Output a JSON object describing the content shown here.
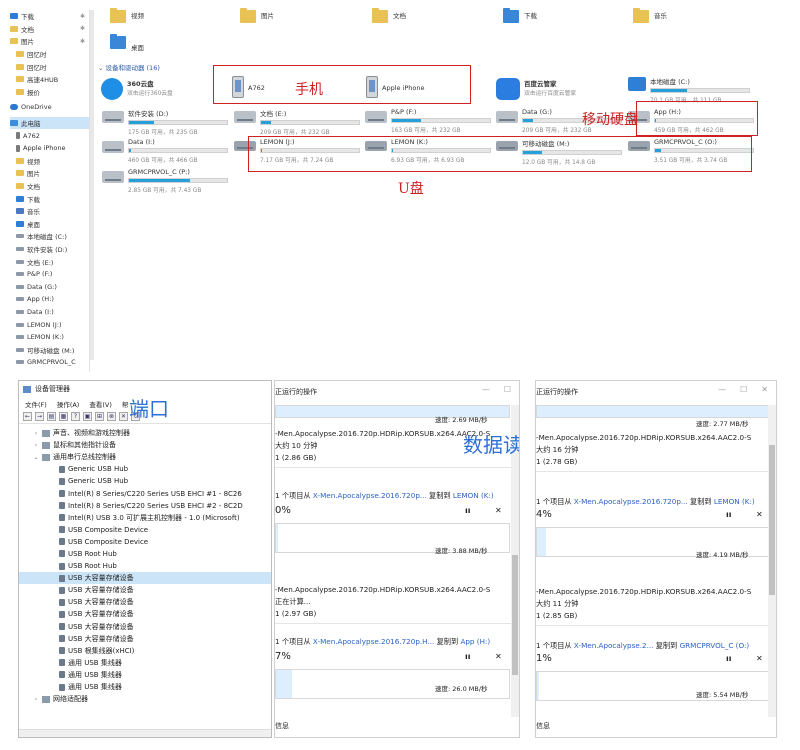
{
  "explorer": {
    "nav": [
      {
        "label": "下载",
        "icon": "download-icon",
        "pin": true
      },
      {
        "label": "文档",
        "icon": "document-icon",
        "pin": true
      },
      {
        "label": "图片",
        "icon": "pictures-icon",
        "pin": true
      },
      {
        "label": "回忆时",
        "icon": "folder-icon"
      },
      {
        "label": "回忆时",
        "icon": "folder-icon"
      },
      {
        "label": "高速4HUB",
        "icon": "folder-icon"
      },
      {
        "label": "报价",
        "icon": "folder-icon"
      },
      {
        "label": "OneDrive",
        "icon": "cloud-icon"
      },
      {
        "label": "此电脑",
        "icon": "computer-icon"
      },
      {
        "label": "A762",
        "icon": "phone-icon"
      },
      {
        "label": "Apple iPhone",
        "icon": "phone-icon"
      },
      {
        "label": "视频",
        "icon": "video-icon"
      },
      {
        "label": "图片",
        "icon": "pictures-icon"
      },
      {
        "label": "文档",
        "icon": "document-icon"
      },
      {
        "label": "下载",
        "icon": "download-icon"
      },
      {
        "label": "音乐",
        "icon": "music-icon"
      },
      {
        "label": "桌面",
        "icon": "desktop-icon"
      },
      {
        "label": "本地磁盘 (C:)",
        "icon": "drive-icon"
      },
      {
        "label": "软件安装 (D:)",
        "icon": "drive-icon"
      },
      {
        "label": "文档 (E:)",
        "icon": "drive-icon"
      },
      {
        "label": "P&P (F:)",
        "icon": "drive-icon"
      },
      {
        "label": "Data (G:)",
        "icon": "drive-icon"
      },
      {
        "label": "App (H:)",
        "icon": "drive-icon"
      },
      {
        "label": "Data (I:)",
        "icon": "drive-icon"
      },
      {
        "label": "LEMON (J:)",
        "icon": "drive-icon"
      },
      {
        "label": "LEMON (K:)",
        "icon": "drive-icon"
      },
      {
        "label": "可移动磁盘 (M:)",
        "icon": "drive-icon"
      },
      {
        "label": "GRMCPRVOL_C",
        "icon": "drive-icon"
      }
    ],
    "folders": [
      {
        "label": "视频",
        "icon": "video-folder-icon"
      },
      {
        "label": "图片",
        "icon": "pictures-folder-icon"
      },
      {
        "label": "文档",
        "icon": "documents-folder-icon"
      },
      {
        "label": "下载",
        "icon": "downloads-folder-icon"
      },
      {
        "label": "音乐",
        "icon": "music-folder-icon"
      },
      {
        "label": "桌面",
        "icon": "desktop-folder-icon"
      }
    ],
    "section_title": "设备和驱动器 (16)",
    "apps": [
      {
        "name": "360云盘",
        "sub": "双击运行360云盘"
      },
      {
        "name": "百度云管家",
        "sub": "双击运行百度云管家"
      }
    ],
    "phones": [
      {
        "name": "A762"
      },
      {
        "name": "Apple iPhone"
      }
    ],
    "drives": [
      {
        "name": "本地磁盘 (C:)",
        "size": "70.1 GB 可用，共 111 GB",
        "used_fraction": 0.37,
        "icon": "windows-drive-icon"
      },
      {
        "name": "软件安装 (D:)",
        "size": "175 GB 可用，共 235 GB",
        "used_fraction": 0.26
      },
      {
        "name": "文档 (E:)",
        "size": "209 GB 可用，共 232 GB",
        "used_fraction": 0.1
      },
      {
        "name": "P&P (F:)",
        "size": "163 GB 可用，共 232 GB",
        "used_fraction": 0.3
      },
      {
        "name": "Data (G:)",
        "size": "209 GB 可用，共 232 GB",
        "used_fraction": 0.1
      },
      {
        "name": "App (H:)",
        "size": "459 GB 可用，共 462 GB",
        "used_fraction": 0.01
      },
      {
        "name": "Data (I:)",
        "size": "460 GB 可用，共 466 GB",
        "used_fraction": 0.02
      },
      {
        "name": "LEMON (J:)",
        "size": "7.17 GB 可用，共 7.24 GB",
        "used_fraction": 0.01
      },
      {
        "name": "LEMON (K:)",
        "size": "6.93 GB 可用，共 6.93 GB",
        "used_fraction": 0.0
      },
      {
        "name": "可移动磁盘 (M:)",
        "size": "12.0 GB 可用，共 14.8 GB",
        "used_fraction": 0.19
      },
      {
        "name": "GRMCPRVOL_C (O:)",
        "size": "3.51 GB 可用，共 3.74 GB",
        "used_fraction": 0.06
      },
      {
        "name": "GRMCPRVOL_C (P:)",
        "size": "2.85 GB 可用，共 7.43 GB",
        "used_fraction": 0.62
      }
    ],
    "annotations": {
      "phone": "手机",
      "hdd": "移动硬盘",
      "udisk": "U盘",
      "port": "端口",
      "rw": "数据读写"
    },
    "colors": {
      "annotation_red": "#cc2222",
      "annotation_blue": "#2c6fd6",
      "bar_fill": "#26a0da"
    }
  },
  "devmgr": {
    "title": "设备管理器",
    "menu": [
      "文件(F)",
      "操作(A)",
      "查看(V)",
      "帮"
    ],
    "tree": [
      {
        "label": "声音、视频和游戏控制器",
        "level": 1,
        "expander": "›"
      },
      {
        "label": "鼠标和其他指针设备",
        "level": 1,
        "expander": "›"
      },
      {
        "label": "通用串行总线控制器",
        "level": 1,
        "expander": "⌄"
      },
      {
        "label": "Generic USB Hub",
        "level": 2
      },
      {
        "label": "Generic USB Hub",
        "level": 2
      },
      {
        "label": "Intel(R) 8 Series/C220 Series USB EHCI #1 - 8C26",
        "level": 2
      },
      {
        "label": "Intel(R) 8 Series/C220 Series USB EHCI #2 - 8C2D",
        "level": 2
      },
      {
        "label": "Intel(R) USB 3.0 可扩展主机控制器 - 1.0 (Microsoft)",
        "level": 2
      },
      {
        "label": "USB Composite Device",
        "level": 2
      },
      {
        "label": "USB Composite Device",
        "level": 2
      },
      {
        "label": "USB Root Hub",
        "level": 2
      },
      {
        "label": "USB Root Hub",
        "level": 2
      },
      {
        "label": "USB 大容量存储设备",
        "level": 2,
        "selected": true
      },
      {
        "label": "USB 大容量存储设备",
        "level": 2
      },
      {
        "label": "USB 大容量存储设备",
        "level": 2
      },
      {
        "label": "USB 大容量存储设备",
        "level": 2
      },
      {
        "label": "USB 大容量存储设备",
        "level": 2
      },
      {
        "label": "USB 大容量存储设备",
        "level": 2
      },
      {
        "label": "USB 根集线器(xHCI)",
        "level": 2
      },
      {
        "label": "通用 USB 集线器",
        "level": 2
      },
      {
        "label": "通用 USB 集线器",
        "level": 2
      },
      {
        "label": "通用 USB 集线器",
        "level": 2
      },
      {
        "label": "网络适配器",
        "level": 1,
        "expander": "›"
      }
    ]
  },
  "copy1": {
    "title": "正运行的操作",
    "speed_top": "速度: 2.69 MB/秒",
    "file_a": "-Men.Apocalypse.2016.720p.HDRip.KORSUB.x264.AAC2.0-S",
    "remain_a": "大约 10 分钟",
    "items_a": "1 (2.86 GB)",
    "copy_line_b_prefix": "1 个项目从 ",
    "copy_line_b_src": "X-Men.Apocalypse.2016.720p...",
    "copy_line_b_mid": " 复制到 ",
    "copy_line_b_dst": "LEMON (K:)",
    "pct_b": "0%",
    "speed_b": "速度: 3.88 MB/秒",
    "file_c": "-Men.Apocalypse.2016.720p.HDRip.KORSUB.x264.AAC2.0-S",
    "remain_c": "正在计算...",
    "items_c": "1 (2.97 GB)",
    "copy_line_d_prefix": "1 个项目从 ",
    "copy_line_d_src": "X-Men.Apocalypse.2016.720p.H...",
    "copy_line_d_mid": " 复制到 ",
    "copy_line_d_dst": "App (H:)",
    "pct_d": "7%",
    "speed_d": "速度: 26.0 MB/秒",
    "footer": "信息"
  },
  "copy2": {
    "title": "正运行的操作",
    "speed_top": "速度: 2.77 MB/秒",
    "file_a": "-Men.Apocalypse.2016.720p.HDRip.KORSUB.x264.AAC2.0-S",
    "remain_a": "大约 16 分钟",
    "items_a": "1 (2.78 GB)",
    "copy_line_b_prefix": "1 个项目从 ",
    "copy_line_b_src": "X-Men.Apocalypse.2016.720p...",
    "copy_line_b_mid": " 复制到 ",
    "copy_line_b_dst": "LEMON (K:)",
    "pct_b": "4%",
    "speed_b": "速度: 4.19 MB/秒",
    "file_c": "-Men.Apocalypse.2016.720p.HDRip.KORSUB.x264.AAC2.0-S",
    "remain_c": "大约 11 分钟",
    "items_c": "1 (2.85 GB)",
    "copy_line_d_prefix": "1 个项目从 ",
    "copy_line_d_src": "X-Men.Apocalypse.2...",
    "copy_line_d_mid": " 复制到 ",
    "copy_line_d_dst": "GRMCPRVOL_C (O:)",
    "pct_d": "1%",
    "speed_d": "速度: 5.54 MB/秒",
    "footer": "信息"
  }
}
